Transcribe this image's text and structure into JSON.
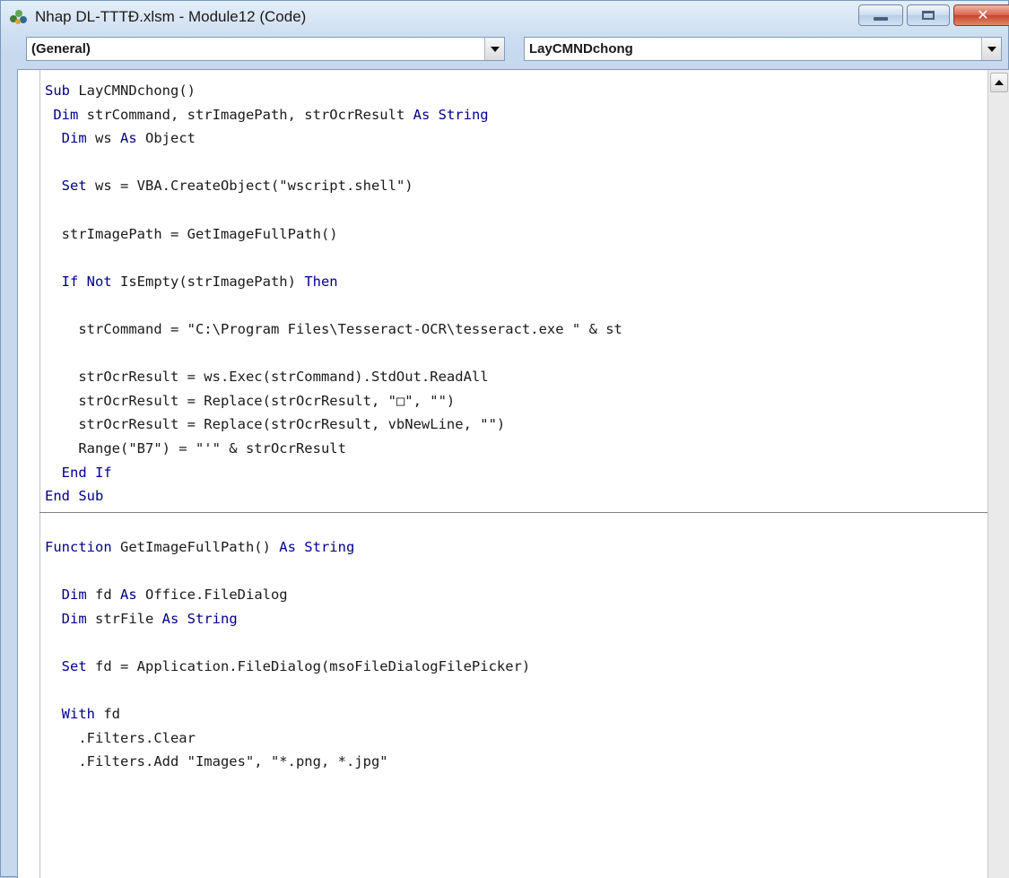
{
  "window": {
    "title": "Nhap DL-TTTĐ.xlsm - Module12 (Code)",
    "icon": "vba-module-icon",
    "buttons": {
      "minimize": "minimize-icon",
      "maximize": "maximize-icon",
      "close": "close-icon",
      "close_glyph": "✕"
    }
  },
  "object_combo": {
    "value": "(General)"
  },
  "procedure_combo": {
    "value": "LayCMNDchong"
  },
  "colors": {
    "keyword": "#00008b",
    "text": "#1a1a1a",
    "close_button": "#c7442b"
  },
  "code_lines": [
    [
      [
        "kw",
        "Sub"
      ],
      [
        "tx",
        " LayCMNDchong()"
      ]
    ],
    [
      [
        "tx",
        " "
      ],
      [
        "kw",
        "Dim"
      ],
      [
        "tx",
        " strCommand, strImagePath, strOcrResult "
      ],
      [
        "kw",
        "As String"
      ]
    ],
    [
      [
        "tx",
        "  "
      ],
      [
        "kw",
        "Dim"
      ],
      [
        "tx",
        " ws "
      ],
      [
        "kw",
        "As"
      ],
      [
        "tx",
        " Object"
      ]
    ],
    [],
    [
      [
        "tx",
        "  "
      ],
      [
        "kw",
        "Set"
      ],
      [
        "tx",
        " ws = VBA.CreateObject(\"wscript.shell\")"
      ]
    ],
    [],
    [
      [
        "tx",
        "  strImagePath = GetImageFullPath()"
      ]
    ],
    [],
    [
      [
        "tx",
        "  "
      ],
      [
        "kw",
        "If Not"
      ],
      [
        "tx",
        " IsEmpty(strImagePath) "
      ],
      [
        "kw",
        "Then"
      ]
    ],
    [],
    [
      [
        "tx",
        "    strCommand = \"C:\\Program Files\\Tesseract-OCR\\tesseract.exe \" & st"
      ]
    ],
    [],
    [
      [
        "tx",
        "    strOcrResult = ws.Exec(strCommand).StdOut.ReadAll"
      ]
    ],
    [
      [
        "tx",
        "    strOcrResult = Replace(strOcrResult, \"□\", \"\")"
      ]
    ],
    [
      [
        "tx",
        "    strOcrResult = Replace(strOcrResult, vbNewLine, \"\")"
      ]
    ],
    [
      [
        "tx",
        "    Range(\"B7\") = \"'\" & strOcrResult"
      ]
    ],
    [
      [
        "tx",
        "  "
      ],
      [
        "kw",
        "End If"
      ]
    ],
    [
      [
        "kw",
        "End Sub"
      ]
    ],
    null,
    [
      [
        "kw",
        "Function"
      ],
      [
        "tx",
        " GetImageFullPath() "
      ],
      [
        "kw",
        "As String"
      ]
    ],
    [],
    [
      [
        "tx",
        "  "
      ],
      [
        "kw",
        "Dim"
      ],
      [
        "tx",
        " fd "
      ],
      [
        "kw",
        "As"
      ],
      [
        "tx",
        " Office.FileDialog"
      ]
    ],
    [
      [
        "tx",
        "  "
      ],
      [
        "kw",
        "Dim"
      ],
      [
        "tx",
        " strFile "
      ],
      [
        "kw",
        "As String"
      ]
    ],
    [],
    [
      [
        "tx",
        "  "
      ],
      [
        "kw",
        "Set"
      ],
      [
        "tx",
        " fd = Application.FileDialog(msoFileDialogFilePicker)"
      ]
    ],
    [],
    [
      [
        "tx",
        "  "
      ],
      [
        "kw",
        "With"
      ],
      [
        "tx",
        " fd"
      ]
    ],
    [
      [
        "tx",
        "    .Filters.Clear"
      ]
    ],
    [
      [
        "tx",
        "    .Filters.Add \"Images\", \"*.png, *.jpg\""
      ]
    ]
  ]
}
